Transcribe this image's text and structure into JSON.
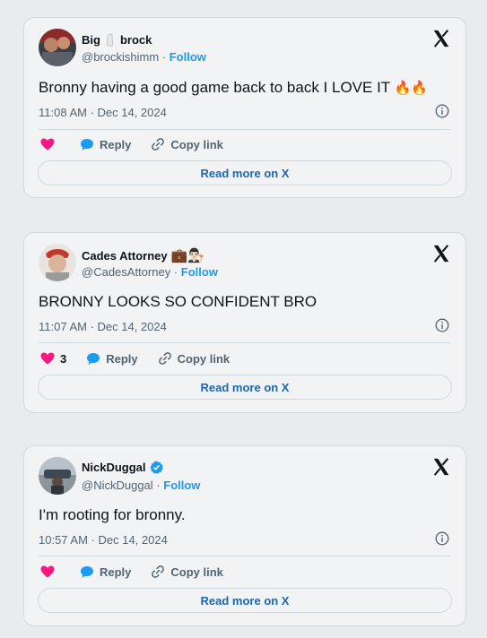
{
  "tweets": [
    {
      "display_name_part1": "Big",
      "display_name_part2": "brock",
      "handle": "@brockishimm",
      "follow_label": "Follow",
      "text": "Bronny having a good game back to back I LOVE IT",
      "text_emoji": "🔥🔥",
      "timestamp": "11:08 AM · Dec 14, 2024",
      "like_count": "",
      "reply_label": "Reply",
      "copy_link_label": "Copy link",
      "read_more_label": "Read more on X"
    },
    {
      "display_name": "Cades Attorney",
      "name_emoji": "💼👨🏻‍⚖️",
      "handle": "@CadesAttorney",
      "follow_label": "Follow",
      "text": "BRONNY LOOKS SO CONFIDENT BRO",
      "timestamp": "11:07 AM · Dec 14, 2024",
      "like_count": "3",
      "reply_label": "Reply",
      "copy_link_label": "Copy link",
      "read_more_label": "Read more on X"
    },
    {
      "display_name": "NickDuggal",
      "verified": true,
      "handle": "@NickDuggal",
      "follow_label": "Follow",
      "text": "I'm rooting for bronny.",
      "timestamp": "10:57 AM · Dec 14, 2024",
      "like_count": "",
      "reply_label": "Reply",
      "copy_link_label": "Copy link",
      "read_more_label": "Read more on X"
    }
  ],
  "colors": {
    "like": "#f91880",
    "reply": "#1d9bf0",
    "link": "#1d67b0",
    "verified": "#1d9bf0"
  }
}
